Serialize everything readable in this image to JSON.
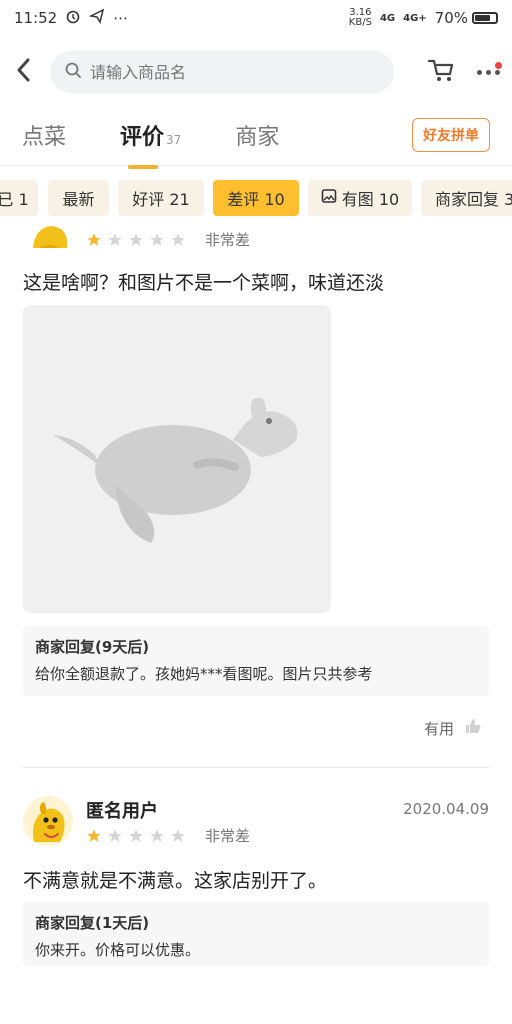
{
  "status": {
    "time": "11:52",
    "net_speed_value": "3.16",
    "net_speed_unit": "KB/S",
    "signal_1": "4G",
    "signal_2": "4G+",
    "battery": "70%"
  },
  "header": {
    "search_placeholder": "请输入商品名"
  },
  "tabs": [
    {
      "label": "点菜"
    },
    {
      "label": "评价",
      "count": "37"
    },
    {
      "label": "商家"
    }
  ],
  "group_buy_label": "好友拼单",
  "filter_chips": [
    {
      "label": "已 1"
    },
    {
      "label": "最新"
    },
    {
      "label": "好评 21"
    },
    {
      "label": "差评 10"
    },
    {
      "label": "有图 10"
    },
    {
      "label": "商家回复 3"
    }
  ],
  "reviews": [
    {
      "rating_text": "非常差",
      "text": "这是啥啊？和图片不是一个菜啊，味道还淡",
      "reply_title": "商家回复(9天后)",
      "reply_text": "给你全额退款了。孩她妈***看图呢。图片只共参考",
      "useful_label": "有用"
    },
    {
      "user_name": "匿名用户",
      "date": "2020.04.09",
      "rating_text": "非常差",
      "text": "不满意就是不满意。这家店别开了。",
      "reply_title": "商家回复(1天后)",
      "reply_text": "你来开。价格可以优惠。"
    }
  ],
  "colors": {
    "accent": "#ffbf2f",
    "group_buy": "#f07a2a",
    "star_filled": "#f7b72d",
    "star_empty": "#d5d5d5"
  }
}
